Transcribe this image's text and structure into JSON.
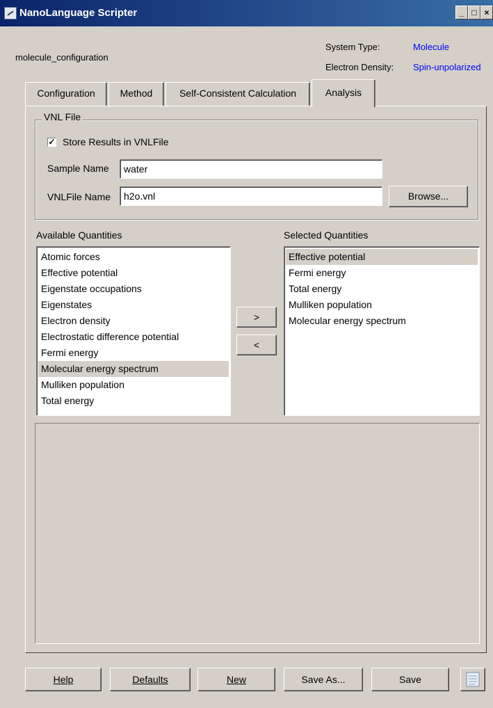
{
  "window": {
    "title": "NanoLanguage Scripter",
    "minimize": "_",
    "maximize": "□",
    "close": "×"
  },
  "header": {
    "config_name": "molecule_configuration",
    "system_type_label": "System Type:",
    "system_type_value": "Molecule",
    "electron_density_label": "Electron Density:",
    "electron_density_value": "Spin-unpolarized",
    "accent_color": "#0000ff"
  },
  "tabs": [
    {
      "label": "Configuration"
    },
    {
      "label": "Method"
    },
    {
      "label": "Self-Consistent Calculation"
    },
    {
      "label": "Analysis",
      "active": true
    }
  ],
  "vnl_file": {
    "legend": "VNL File",
    "store_checkbox_label": "Store Results in VNLFile",
    "store_checked": true,
    "check_mark": "✓",
    "sample_name_label": "Sample Name",
    "sample_name_value": "water",
    "vnlfile_name_label": "VNLFile Name",
    "vnlfile_name_value": "h2o.vnl",
    "browse_label": "Browse..."
  },
  "available": {
    "heading": "Available Quantities",
    "items": [
      "Atomic forces",
      "Effective potential",
      "Eigenstate occupations",
      "Eigenstates",
      "Electron density",
      "Electrostatic difference potential",
      "Fermi energy",
      "Molecular energy spectrum",
      "Mulliken population",
      "Total energy"
    ],
    "selected_item": "Molecular energy spectrum"
  },
  "transfer": {
    "add_label": ">",
    "remove_label": "<"
  },
  "selected": {
    "heading": "Selected Quantities",
    "items": [
      "Effective potential",
      "Fermi energy",
      "Total energy",
      "Mulliken population",
      "Molecular energy spectrum"
    ],
    "selected_item": "Effective potential"
  },
  "footer": {
    "help_label": "Help",
    "defaults_label": "Defaults",
    "new_label": "New",
    "save_as_label": "Save As...",
    "save_label": "Save",
    "script_icon": "document-icon"
  }
}
